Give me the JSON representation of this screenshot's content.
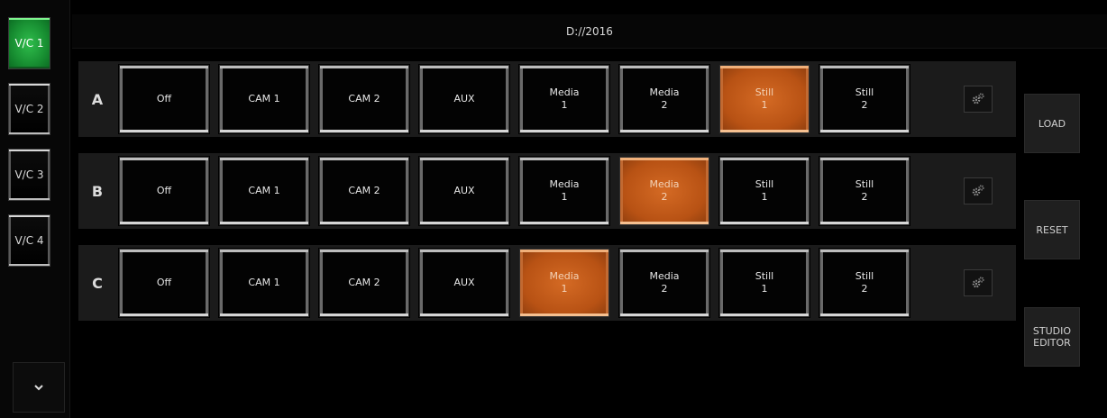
{
  "header": {
    "title": "D://2016"
  },
  "sidebar": {
    "items": [
      {
        "label": "V/C 1",
        "active": true
      },
      {
        "label": "V/C 2",
        "active": false
      },
      {
        "label": "V/C 3",
        "active": false
      },
      {
        "label": "V/C 4",
        "active": false
      }
    ],
    "scroll_icon": "chevron-down-icon"
  },
  "rows": [
    {
      "letter": "A",
      "buttons": [
        {
          "line1": "Off",
          "line2": "",
          "active": false
        },
        {
          "line1": "CAM 1",
          "line2": "",
          "active": false
        },
        {
          "line1": "CAM 2",
          "line2": "",
          "active": false
        },
        {
          "line1": "AUX",
          "line2": "",
          "active": false
        },
        {
          "line1": "Media",
          "line2": "1",
          "active": false
        },
        {
          "line1": "Media",
          "line2": "2",
          "active": false
        },
        {
          "line1": "Still",
          "line2": "1",
          "active": true
        },
        {
          "line1": "Still",
          "line2": "2",
          "active": false
        }
      ],
      "settings_icon": "gear-icon"
    },
    {
      "letter": "B",
      "buttons": [
        {
          "line1": "Off",
          "line2": "",
          "active": false
        },
        {
          "line1": "CAM 1",
          "line2": "",
          "active": false
        },
        {
          "line1": "CAM 2",
          "line2": "",
          "active": false
        },
        {
          "line1": "AUX",
          "line2": "",
          "active": false
        },
        {
          "line1": "Media",
          "line2": "1",
          "active": false
        },
        {
          "line1": "Media",
          "line2": "2",
          "active": true
        },
        {
          "line1": "Still",
          "line2": "1",
          "active": false
        },
        {
          "line1": "Still",
          "line2": "2",
          "active": false
        }
      ],
      "settings_icon": "gear-icon"
    },
    {
      "letter": "C",
      "buttons": [
        {
          "line1": "Off",
          "line2": "",
          "active": false
        },
        {
          "line1": "CAM 1",
          "line2": "",
          "active": false
        },
        {
          "line1": "CAM 2",
          "line2": "",
          "active": false
        },
        {
          "line1": "AUX",
          "line2": "",
          "active": false
        },
        {
          "line1": "Media",
          "line2": "1",
          "active": true
        },
        {
          "line1": "Media",
          "line2": "2",
          "active": false
        },
        {
          "line1": "Still",
          "line2": "1",
          "active": false
        },
        {
          "line1": "Still",
          "line2": "2",
          "active": false
        }
      ],
      "settings_icon": "gear-icon"
    }
  ],
  "actions": {
    "load": "LOAD",
    "reset": "RESET",
    "studio_editor": "STUDIO\nEDITOR"
  },
  "colors": {
    "active_green": "#188f32",
    "active_orange": "#b85214",
    "row_background": "#1b1b1b"
  }
}
